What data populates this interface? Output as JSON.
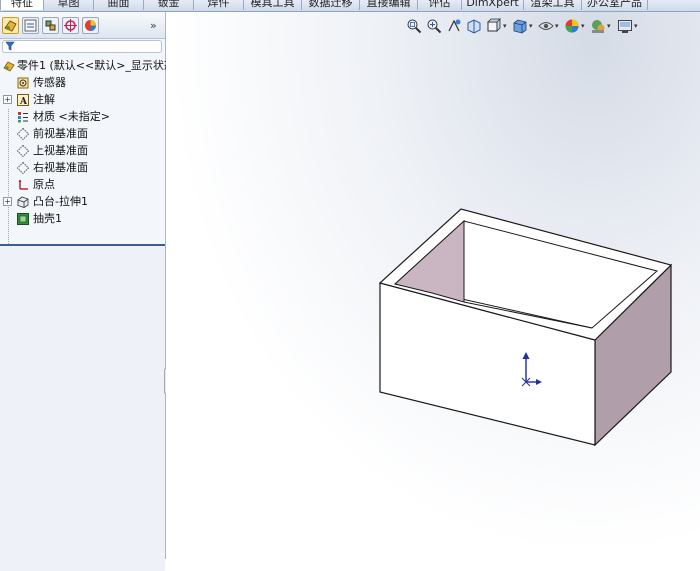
{
  "command_tabs": [
    {
      "label": "特征",
      "active": true
    },
    {
      "label": "草图",
      "active": false
    },
    {
      "label": "曲面",
      "active": false
    },
    {
      "label": "钣金",
      "active": false
    },
    {
      "label": "焊件",
      "active": false
    },
    {
      "label": "模具工具",
      "active": false
    },
    {
      "label": "数据迁移",
      "active": false
    },
    {
      "label": "直接编辑",
      "active": false
    },
    {
      "label": "评估",
      "active": false
    },
    {
      "label": "DimXpert",
      "active": false
    },
    {
      "label": "渲染工具",
      "active": false
    },
    {
      "label": "办公室产品",
      "active": false
    }
  ],
  "panel": {
    "expand_label": "»",
    "tabs": [
      {
        "icon": "feature-manager-icon",
        "active": true
      },
      {
        "icon": "property-manager-icon",
        "active": false
      },
      {
        "icon": "configuration-manager-icon",
        "active": false
      },
      {
        "icon": "dimxpert-manager-icon",
        "active": false
      },
      {
        "icon": "display-manager-icon",
        "active": false
      }
    ]
  },
  "tree": {
    "root": "零件1  (默认<<默认>_显示状态",
    "items": [
      {
        "label": "传感器",
        "icon": "sensor-icon",
        "expandable": false
      },
      {
        "label": "注解",
        "icon": "annotation-icon",
        "expandable": true
      },
      {
        "label": "材质 <未指定>",
        "icon": "material-icon",
        "expandable": false
      },
      {
        "label": "前视基准面",
        "icon": "plane-icon",
        "expandable": false
      },
      {
        "label": "上视基准面",
        "icon": "plane-icon",
        "expandable": false
      },
      {
        "label": "右视基准面",
        "icon": "plane-icon",
        "expandable": false
      },
      {
        "label": "原点",
        "icon": "origin-icon",
        "expandable": false
      },
      {
        "label": "凸台-拉伸1",
        "icon": "extrude-icon",
        "expandable": true
      },
      {
        "label": "抽壳1",
        "icon": "shell-icon",
        "expandable": false
      }
    ]
  },
  "colors": {
    "box_front": "#ffffff",
    "box_side": "#b09fab",
    "box_inner_wall": "#c9b6c2",
    "edges": "#1a1a1a",
    "origin_triad": "#1a2fa8",
    "tree_accent": "#3b5f8f"
  }
}
